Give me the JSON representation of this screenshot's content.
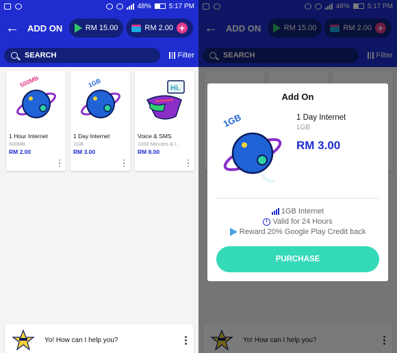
{
  "status_bar": {
    "battery": "48%",
    "time": "5:17 PM"
  },
  "app_bar": {
    "title": "ADD ON",
    "google_play_balance": "RM 15.00",
    "wallet_balance": "RM 2.00",
    "add_symbol": "+"
  },
  "search": {
    "placeholder": "SEARCH",
    "filter_label": "Filter"
  },
  "products": [
    {
      "art_label": "500MB",
      "title": "1 Hour Internet",
      "subtitle": "500MB",
      "price": "RM 2.00"
    },
    {
      "art_label": "1GB",
      "title": "1 Day Internet",
      "subtitle": "1GB",
      "price": "RM 3.00"
    },
    {
      "art_label": "Hi.",
      "title": "Voice & SMS",
      "subtitle": "1000 Minutes & l...",
      "price": "RM 8.00"
    }
  ],
  "chat": {
    "prompt": "Yo! How can I help you?"
  },
  "modal": {
    "title": "Add On",
    "product_name": "1 Day Internet",
    "product_sub": "1GB",
    "art_label": "1GB",
    "price": "RM 3.00",
    "features": [
      "1GB Internet",
      "Valid for 24 Hours",
      "Reward 20% Google Play Credit back"
    ],
    "purchase_label": "PURCHASE"
  },
  "colors": {
    "brand_blue": "#1f2dd0",
    "accent_pink": "#e13b8a",
    "purchase_teal": "#34d9b8"
  }
}
